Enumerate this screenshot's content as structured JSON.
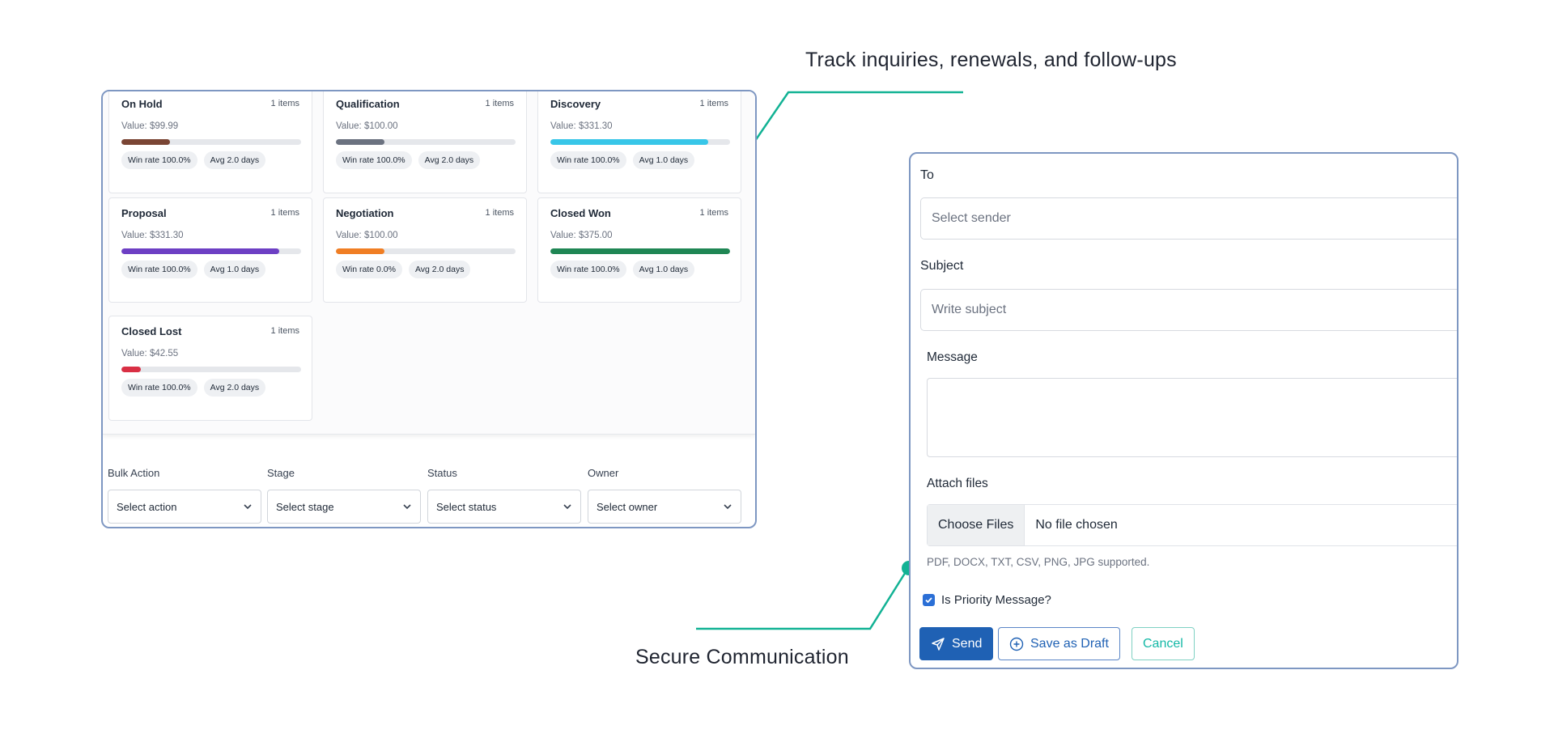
{
  "captions": {
    "top": "Track inquiries, renewals, and follow-ups",
    "bottom": "Secure Communication"
  },
  "colors": {
    "accent_teal": "#12b294",
    "panel_border": "#7e97c2",
    "primary_blue": "#1f61b4"
  },
  "pipeline": {
    "stages": [
      {
        "name": "On Hold",
        "count": "1 items",
        "value": "Value: $99.99",
        "progress": 0.27,
        "color": "#7a4534",
        "win": "Win rate 100.0%",
        "avg": "Avg 2.0 days"
      },
      {
        "name": "Qualification",
        "count": "1 items",
        "value": "Value: $100.00",
        "progress": 0.27,
        "color": "#6b7280",
        "win": "Win rate 100.0%",
        "avg": "Avg 2.0 days"
      },
      {
        "name": "Discovery",
        "count": "1 items",
        "value": "Value: $331.30",
        "progress": 0.88,
        "color": "#38c6e8",
        "win": "Win rate 100.0%",
        "avg": "Avg 1.0 days"
      },
      {
        "name": "Proposal",
        "count": "1 items",
        "value": "Value: $331.30",
        "progress": 0.88,
        "color": "#6d3fc4",
        "win": "Win rate 100.0%",
        "avg": "Avg 1.0 days"
      },
      {
        "name": "Negotiation",
        "count": "1 items",
        "value": "Value: $100.00",
        "progress": 0.27,
        "color": "#f07e24",
        "win": "Win rate 0.0%",
        "avg": "Avg 2.0 days"
      },
      {
        "name": "Closed Won",
        "count": "1 items",
        "value": "Value: $375.00",
        "progress": 1.0,
        "color": "#1f8654",
        "win": "Win rate 100.0%",
        "avg": "Avg 1.0 days"
      },
      {
        "name": "Closed Lost",
        "count": "1 items",
        "value": "Value: $42.55",
        "progress": 0.11,
        "color": "#d92f44",
        "win": "Win rate 100.0%",
        "avg": "Avg 2.0 days"
      }
    ],
    "filters": [
      {
        "label": "Bulk Action",
        "placeholder": "Select action"
      },
      {
        "label": "Stage",
        "placeholder": "Select stage"
      },
      {
        "label": "Status",
        "placeholder": "Select status"
      },
      {
        "label": "Owner",
        "placeholder": "Select owner"
      }
    ]
  },
  "message": {
    "to_label": "To",
    "to_placeholder": "Select sender",
    "subject_label": "Subject",
    "subject_placeholder": "Write subject",
    "message_label": "Message",
    "attach_label": "Attach files",
    "choose_files": "Choose Files",
    "no_file": "No file chosen",
    "supported": "PDF, DOCX, TXT, CSV, PNG, JPG supported.",
    "priority_label": "Is Priority Message?",
    "priority_checked": true,
    "send": "Send",
    "save_draft": "Save as Draft",
    "cancel": "Cancel"
  }
}
